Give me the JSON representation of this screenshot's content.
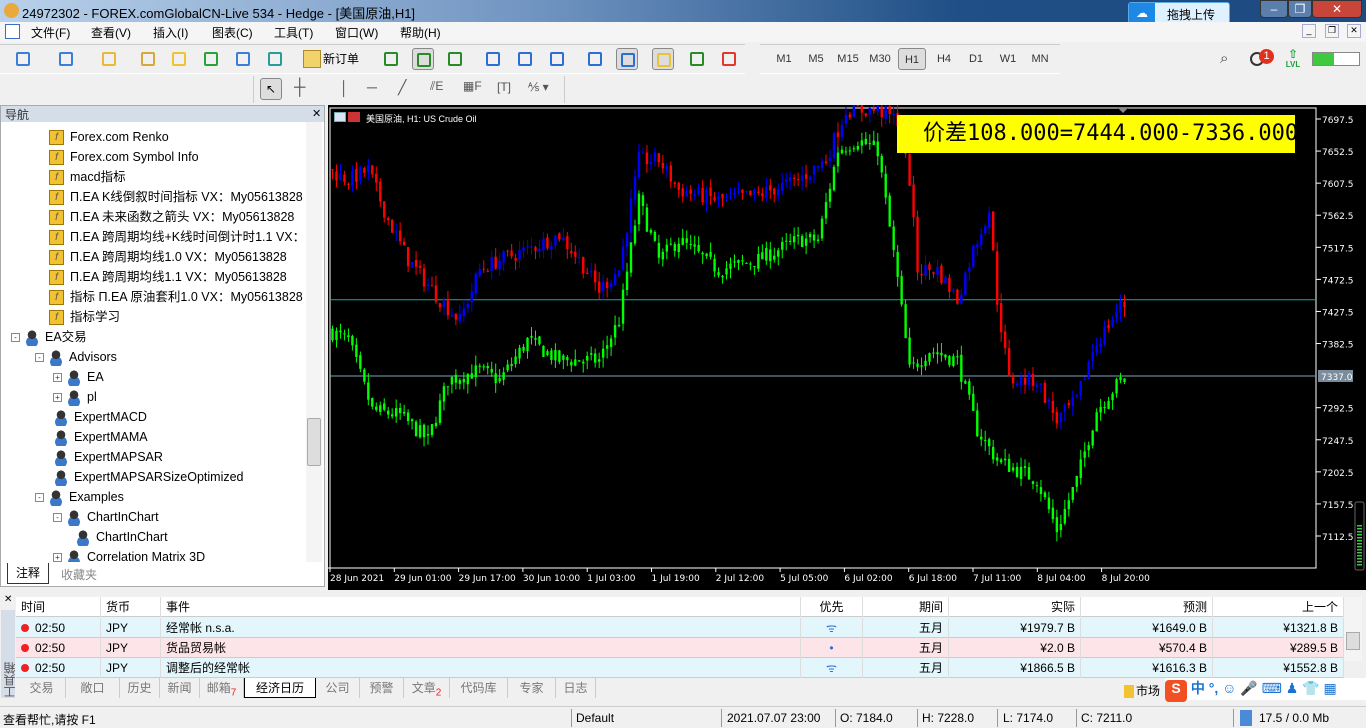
{
  "window": {
    "title": "24972302 - FOREX.comGlobalCN-Live 534 - Hedge - [美国原油,H1]",
    "upload": "拖拽上传"
  },
  "menu": [
    "文件(F)",
    "查看(V)",
    "插入(I)",
    "图表(C)",
    "工具(T)",
    "窗口(W)",
    "帮助(H)"
  ],
  "toolbar": {
    "new_order": "新订单",
    "timeframes": [
      "M1",
      "M5",
      "M15",
      "M30",
      "H1",
      "H4",
      "D1",
      "W1",
      "MN"
    ],
    "selected_timeframe": "H1",
    "notification_count": "1",
    "lvl": "LVL",
    "signal_level": 0.45
  },
  "navigator": {
    "title": "导航",
    "items": [
      {
        "label": "Forex.com Renko",
        "type": "indicator",
        "level": 2
      },
      {
        "label": "Forex.com Symbol Info",
        "type": "indicator",
        "level": 2
      },
      {
        "label": "macd指标",
        "type": "indicator",
        "level": 2
      },
      {
        "label": "Π.EA K线倒叙时间指标 VX：My05613828",
        "type": "indicator",
        "level": 2
      },
      {
        "label": "Π.EA 未来函数之箭头 VX：My05613828",
        "type": "indicator",
        "level": 2
      },
      {
        "label": "Π.EA 跨周期均线+K线时间倒计时1.1 VX：M",
        "type": "indicator",
        "level": 2
      },
      {
        "label": "Π.EA 跨周期均线1.0 VX：My05613828",
        "type": "indicator",
        "level": 2
      },
      {
        "label": "Π.EA 跨周期均线1.1 VX：My05613828",
        "type": "indicator",
        "level": 2
      },
      {
        "label": "指标 Π.EA 原油套利1.0 VX：My05613828",
        "type": "indicator",
        "level": 2
      },
      {
        "label": "指标学习",
        "type": "indicator",
        "level": 2
      },
      {
        "label": "EA交易",
        "type": "ea",
        "level": 0,
        "toggle": "-"
      },
      {
        "label": "Advisors",
        "type": "folder",
        "level": 1,
        "toggle": "-"
      },
      {
        "label": "EA",
        "type": "folder",
        "level": 2,
        "toggle": "+"
      },
      {
        "label": "pl",
        "type": "folder",
        "level": 2,
        "toggle": "+"
      },
      {
        "label": "ExpertMACD",
        "type": "ea",
        "level": 2
      },
      {
        "label": "ExpertMAMA",
        "type": "ea",
        "level": 2
      },
      {
        "label": "ExpertMAPSAR",
        "type": "ea",
        "level": 2
      },
      {
        "label": "ExpertMAPSARSizeOptimized",
        "type": "ea",
        "level": 2
      },
      {
        "label": "Examples",
        "type": "folder",
        "level": 1,
        "toggle": "-"
      },
      {
        "label": "ChartInChart",
        "type": "folder",
        "level": 2,
        "toggle": "-"
      },
      {
        "label": "ChartInChart",
        "type": "ea",
        "level": 3
      },
      {
        "label": "Correlation Matrix 3D",
        "type": "folder",
        "level": 2,
        "toggle": "+"
      }
    ],
    "tabs": [
      "注释",
      "收藏夹"
    ]
  },
  "chart_data": {
    "type": "candlestick",
    "title": "美国原油, H1:  US Crude Oil",
    "annotation": "价差108.000=7444.000-7336.000",
    "y_ticks": [
      7697.5,
      7652.5,
      7607.5,
      7562.5,
      7517.5,
      7472.5,
      7427.5,
      7382.5,
      7292.5,
      7247.5,
      7202.5,
      7157.5,
      7112.5
    ],
    "y_tick_labels": [
      "7697.5",
      "7652.5",
      "7607.5",
      "7562.5",
      "7517.5",
      "7472.5",
      "7427.5",
      "7382.5",
      "7292.5",
      "7247.5",
      "7202.5",
      "7157.5",
      "7112.5"
    ],
    "ylim": [
      7090,
      7715
    ],
    "current_price_label": "7337.0",
    "hlines": [
      7444,
      7337
    ],
    "x_labels": [
      "28 Jun 2021",
      "29 Jun 01:00",
      "29 Jun 17:00",
      "30 Jun 10:00",
      "1 Jul 03:00",
      "1 Jul 19:00",
      "2 Jul 12:00",
      "5 Jul 05:00",
      "6 Jul 02:00",
      "6 Jul 18:00",
      "7 Jul 11:00",
      "8 Jul 04:00",
      "8 Jul 20:00"
    ],
    "bars": 200,
    "series": [
      {
        "name": "green",
        "colors": {
          "up": "#00ff00",
          "down": "#00ff00"
        },
        "keypoints": [
          [
            0,
            7401
          ],
          [
            5,
            7387
          ],
          [
            11,
            7289
          ],
          [
            18,
            7282
          ],
          [
            25,
            7247
          ],
          [
            30,
            7331
          ],
          [
            38,
            7345
          ],
          [
            43,
            7331
          ],
          [
            50,
            7387
          ],
          [
            58,
            7359
          ],
          [
            68,
            7359
          ],
          [
            73,
            7415
          ],
          [
            78,
            7584
          ],
          [
            83,
            7500
          ],
          [
            88,
            7528
          ],
          [
            98,
            7486
          ],
          [
            108,
            7500
          ],
          [
            118,
            7528
          ],
          [
            123,
            7528
          ],
          [
            128,
            7654
          ],
          [
            133,
            7668
          ],
          [
            138,
            7654
          ],
          [
            143,
            7472
          ],
          [
            146,
            7345
          ],
          [
            151,
            7373
          ],
          [
            158,
            7359
          ],
          [
            163,
            7261
          ],
          [
            168,
            7219
          ],
          [
            178,
            7191
          ],
          [
            183,
            7121
          ],
          [
            188,
            7191
          ],
          [
            193,
            7289
          ],
          [
            199,
            7331
          ]
        ]
      },
      {
        "name": "redblue",
        "colors": {
          "up": "#0000ff",
          "down": "#ff0000"
        },
        "keypoints": [
          [
            0,
            7626
          ],
          [
            5,
            7612
          ],
          [
            10,
            7626
          ],
          [
            15,
            7556
          ],
          [
            20,
            7500
          ],
          [
            28,
            7444
          ],
          [
            33,
            7415
          ],
          [
            38,
            7486
          ],
          [
            43,
            7500
          ],
          [
            50,
            7514
          ],
          [
            58,
            7535
          ],
          [
            63,
            7500
          ],
          [
            68,
            7458
          ],
          [
            73,
            7486
          ],
          [
            78,
            7640
          ],
          [
            83,
            7640
          ],
          [
            88,
            7598
          ],
          [
            98,
            7584
          ],
          [
            108,
            7591
          ],
          [
            118,
            7612
          ],
          [
            125,
            7640
          ],
          [
            130,
            7710
          ],
          [
            138,
            7710
          ],
          [
            143,
            7696
          ],
          [
            146,
            7612
          ],
          [
            148,
            7486
          ],
          [
            153,
            7486
          ],
          [
            158,
            7444
          ],
          [
            162,
            7514
          ],
          [
            166,
            7570
          ],
          [
            168,
            7444
          ],
          [
            171,
            7331
          ],
          [
            178,
            7331
          ],
          [
            183,
            7275
          ],
          [
            188,
            7303
          ],
          [
            192,
            7373
          ],
          [
            199,
            7436
          ]
        ]
      }
    ]
  },
  "calendar": {
    "headers": [
      "时间",
      "货币",
      "事件",
      "优先",
      "期间",
      "实际",
      "预测",
      "上一个"
    ],
    "rows": [
      {
        "time": "02:50",
        "currency": "JPY",
        "event": "经常帐 n.s.a.",
        "priority": "high",
        "period": "五月",
        "actual": "¥1979.7 B",
        "forecast": "¥1649.0 B",
        "previous": "¥1321.8 B"
      },
      {
        "time": "02:50",
        "currency": "JPY",
        "event": "货品贸易帐",
        "priority": "low",
        "period": "五月",
        "actual": "¥2.0 B",
        "forecast": "¥570.4 B",
        "previous": "¥289.5 B"
      },
      {
        "time": "02:50",
        "currency": "JPY",
        "event": "调整后的经常帐",
        "priority": "high",
        "period": "五月",
        "actual": "¥1866.5 B",
        "forecast": "¥1616.3 B",
        "previous": "¥1552.8 B"
      }
    ]
  },
  "toolbox": {
    "side_label": "工具箱",
    "tabs": [
      {
        "label": "交易"
      },
      {
        "label": "敞口"
      },
      {
        "label": "历史"
      },
      {
        "label": "新闻"
      },
      {
        "label": "邮箱",
        "badge": "7"
      },
      {
        "label": "经济日历"
      },
      {
        "label": "公司"
      },
      {
        "label": "预警"
      },
      {
        "label": "文章",
        "badge": "2"
      },
      {
        "label": "代码库"
      },
      {
        "label": "专家"
      },
      {
        "label": "日志"
      }
    ],
    "active": "经济日历",
    "market": "市场"
  },
  "status": {
    "help": "查看帮忙,请按 F1",
    "profile": "Default",
    "datetime": "2021.07.07 23:00",
    "open": "O: 7184.0",
    "high": "H: 7228.0",
    "low": "L: 7174.0",
    "close": "C: 7211.0",
    "memory": "17.5 / 0.0 Mb"
  }
}
